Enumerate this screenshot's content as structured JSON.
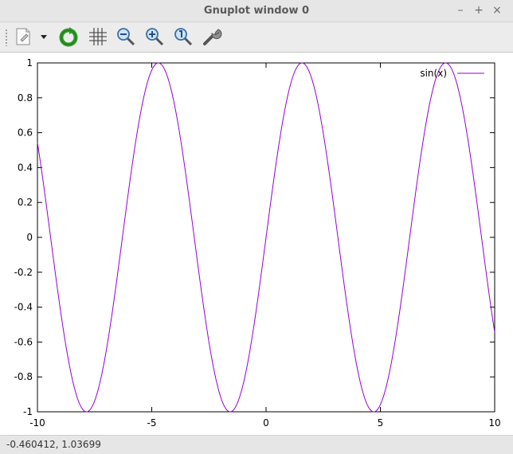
{
  "window": {
    "title": "Gnuplot window 0",
    "minimize_label": "–",
    "maximize_label": "+",
    "close_label": "×"
  },
  "toolbar": {
    "buttons": [
      "export-icon",
      "dropdown-arrow-icon",
      "replot-icon",
      "grid-icon",
      "zoom-previous-icon",
      "zoom-next-icon",
      "unzoom-icon",
      "settings-icon"
    ]
  },
  "status": {
    "coordinates": "-0.460412,  1.03699"
  },
  "colors": {
    "series": "#9400d3"
  },
  "chart_data": {
    "type": "line",
    "function": "sin(x)",
    "title": "",
    "xlabel": "",
    "ylabel": "",
    "xlim": [
      -10,
      10
    ],
    "ylim": [
      -1,
      1
    ],
    "x_ticks": [
      "-10",
      "-5",
      "0",
      "5",
      "10"
    ],
    "y_ticks": [
      "-1",
      "-0.8",
      "-0.6",
      "-0.4",
      "-0.2",
      "0",
      "0.2",
      "0.4",
      "0.6",
      "0.8",
      "1"
    ],
    "legend": "top-right",
    "grid": false,
    "series": [
      {
        "name": "sin(x)",
        "color": "#9400d3"
      }
    ]
  }
}
